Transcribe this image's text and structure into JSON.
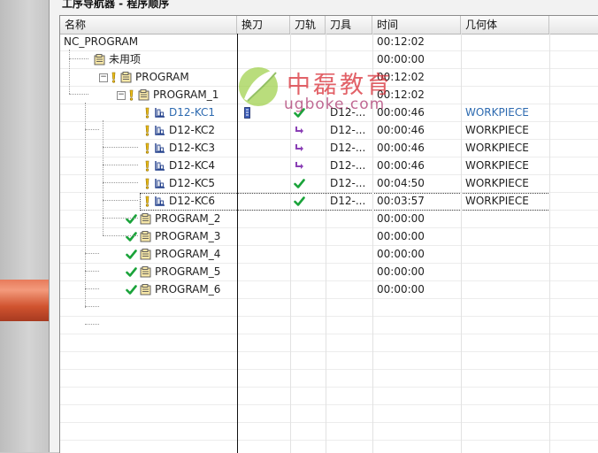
{
  "panel": {
    "title": "工序导航器 - 程序顺序"
  },
  "columns": [
    "名称",
    "换刀",
    "刀轨",
    "刀具",
    "时间",
    "几何体"
  ],
  "rows": [
    {
      "name": "NC_PROGRAM",
      "tool": "",
      "time": "00:12:02",
      "geometry": "",
      "name_color": "#222222",
      "geo_color": "#222222"
    },
    {
      "name": "未用项",
      "tool": "",
      "time": "00:00:00",
      "geometry": "",
      "name_color": "#222222",
      "geo_color": "#222222"
    },
    {
      "name": "PROGRAM",
      "tool": "",
      "time": "00:12:02",
      "geometry": "",
      "name_color": "#222222",
      "geo_color": "#222222"
    },
    {
      "name": "PROGRAM_1",
      "tool": "",
      "time": "00:12:02",
      "geometry": "",
      "name_color": "#222222",
      "geo_color": "#222222"
    },
    {
      "name": "D12-KC1",
      "tool": "D12-...",
      "time": "00:00:46",
      "geometry": "WORKPIECE",
      "name_color": "#2d6ab0",
      "geo_color": "#2d6ab0"
    },
    {
      "name": "D12-KC2",
      "tool": "D12-...",
      "time": "00:00:46",
      "geometry": "WORKPIECE",
      "name_color": "#222222",
      "geo_color": "#222222"
    },
    {
      "name": "D12-KC3",
      "tool": "D12-...",
      "time": "00:00:46",
      "geometry": "WORKPIECE",
      "name_color": "#222222",
      "geo_color": "#222222"
    },
    {
      "name": "D12-KC4",
      "tool": "D12-...",
      "time": "00:00:46",
      "geometry": "WORKPIECE",
      "name_color": "#222222",
      "geo_color": "#222222"
    },
    {
      "name": "D12-KC5",
      "tool": "D12-...",
      "time": "00:04:50",
      "geometry": "WORKPIECE",
      "name_color": "#222222",
      "geo_color": "#222222"
    },
    {
      "name": "D12-KC6",
      "tool": "D12-...",
      "time": "00:03:57",
      "geometry": "WORKPIECE",
      "name_color": "#222222",
      "geo_color": "#222222"
    },
    {
      "name": "PROGRAM_2",
      "tool": "",
      "time": "00:00:00",
      "geometry": "",
      "name_color": "#222222",
      "geo_color": "#222222"
    },
    {
      "name": "PROGRAM_3",
      "tool": "",
      "time": "00:00:00",
      "geometry": "",
      "name_color": "#222222",
      "geo_color": "#222222"
    },
    {
      "name": "PROGRAM_4",
      "tool": "",
      "time": "00:00:00",
      "geometry": "",
      "name_color": "#222222",
      "geo_color": "#222222"
    },
    {
      "name": "PROGRAM_5",
      "tool": "",
      "time": "00:00:00",
      "geometry": "",
      "name_color": "#222222",
      "geo_color": "#222222"
    },
    {
      "name": "PROGRAM_6",
      "tool": "",
      "time": "00:00:00",
      "geometry": "",
      "name_color": "#222222",
      "geo_color": "#222222"
    }
  ],
  "icons": {
    "status_warning": "yellow-exclamation-icon",
    "status_ok": "green-check-icon",
    "group": "program-group-folder-icon",
    "operation": "cavity-mill-operation-icon",
    "toolpath_regen": "purple-regenerate-arrow-icon",
    "toolpath_ok": "green-check-icon",
    "tool_change": "tool-change-icon"
  },
  "watermark": {
    "title": "中磊教育",
    "url": "ugboke.com"
  },
  "colors": {
    "selected_blue": "#2d6ab0",
    "check_green": "#1aa33a",
    "warning_yellow": "#f2c21a",
    "regen_purple": "#8a3fb5"
  }
}
